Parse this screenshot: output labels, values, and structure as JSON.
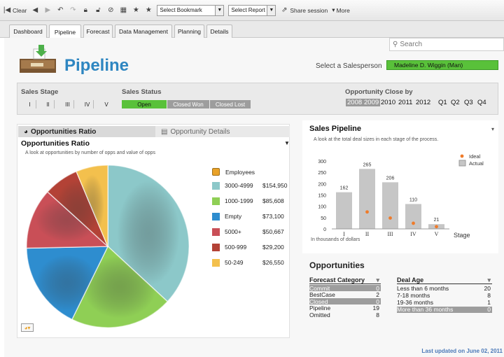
{
  "toolbar": {
    "clear_label": "Clear",
    "bookmark_select": "Select Bookmark",
    "report_select": "Select Report",
    "share_label": "Share session",
    "more_label": "More"
  },
  "tabs": [
    "Dashboard",
    "Pipeline",
    "Forecast",
    "Data Management",
    "Planning",
    "Details"
  ],
  "active_tab": "Pipeline",
  "search": {
    "placeholder": "Search"
  },
  "header": {
    "title": "Pipeline",
    "salesperson_label": "Select a Salesperson",
    "salesperson_value": "Madeline D. Wiggin (Man)"
  },
  "filters": {
    "sales_stage_label": "Sales Stage",
    "stages": [
      "I",
      "II",
      "III",
      "IV",
      "V"
    ],
    "sales_status_label": "Sales Status",
    "statuses": [
      "Open",
      "Closed Won",
      "Closed Lost"
    ],
    "close_by_label": "Opportunity Close by",
    "years": [
      "2008",
      "2009",
      "2010",
      "2011",
      "2012"
    ],
    "quarters": [
      "Q1",
      "Q2",
      "Q3",
      "Q4"
    ]
  },
  "left_panel": {
    "tab_ratio": "Opportunities Ratio",
    "tab_details": "Opportunity Details",
    "heading": "Opportunities Ratio",
    "subtitle": "A look at opportunities by number of opps and value of opps",
    "legend_title": "Employees",
    "legend": [
      {
        "label": "3000-4999",
        "value": "$154,950",
        "color": "#8cc8c9"
      },
      {
        "label": "1000-1999",
        "value": "$85,608",
        "color": "#8fcf55"
      },
      {
        "label": "Empty",
        "value": "$73,100",
        "color": "#2e8dcf"
      },
      {
        "label": "5000+",
        "value": "$50,667",
        "color": "#c94f57"
      },
      {
        "label": "500-999",
        "value": "$29,200",
        "color": "#b34236"
      },
      {
        "label": "50-249",
        "value": "$26,550",
        "color": "#f3c04d"
      }
    ]
  },
  "right_panel": {
    "title": "Sales Pipeline",
    "subtitle": "A look at the total deal sizes in each stage of the process.",
    "legend_ideal": "Ideal",
    "legend_actual": "Actual",
    "x_label": "Stage",
    "y_note": "In thousands of dollars",
    "y_ticks": [
      "300",
      "250",
      "200",
      "150",
      "100",
      "50",
      "0"
    ]
  },
  "chart_data": [
    {
      "type": "pie",
      "title": "Opportunities Ratio",
      "categories": [
        "3000-4999",
        "1000-1999",
        "Empty",
        "5000+",
        "500-999",
        "50-249"
      ],
      "values": [
        154950,
        85608,
        73100,
        50667,
        29200,
        26550
      ]
    },
    {
      "type": "bar",
      "title": "Sales Pipeline",
      "xlabel": "Stage",
      "ylabel": "In thousands of dollars",
      "categories": [
        "I",
        "II",
        "III",
        "IV",
        "V"
      ],
      "ylim": [
        0,
        300
      ],
      "series": [
        {
          "name": "Actual",
          "values": [
            162,
            265,
            206,
            110,
            21
          ]
        },
        {
          "name": "Ideal",
          "values": [
            0,
            75,
            48,
            25,
            10
          ]
        }
      ]
    }
  ],
  "opportunities": {
    "title": "Opportunities",
    "forecast_header": "Forecast Category",
    "forecast": [
      {
        "label": "Commit",
        "value": "0",
        "hl": true
      },
      {
        "label": "BestCase",
        "value": "2",
        "hl": false
      },
      {
        "label": "Closed",
        "value": "0",
        "hl": true
      },
      {
        "label": "Pipeline",
        "value": "19",
        "hl": false
      },
      {
        "label": "Omitted",
        "value": "8",
        "hl": false
      }
    ],
    "deal_age_header": "Deal Age",
    "deal_age": [
      {
        "label": "Less than 6 months",
        "value": "20",
        "hl": false
      },
      {
        "label": "7-18 months",
        "value": "8",
        "hl": false
      },
      {
        "label": "19-36 months",
        "value": "1",
        "hl": false
      },
      {
        "label": "More than 36 months",
        "value": "0",
        "hl": true
      }
    ]
  },
  "footer": {
    "updated": "Last updated on June 02, 2011"
  }
}
